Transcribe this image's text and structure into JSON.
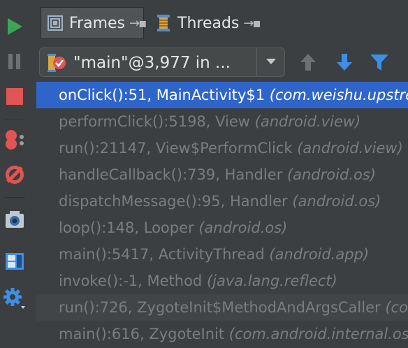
{
  "tabs": [
    {
      "label": "Frames",
      "pin": "→▪"
    },
    {
      "label": "Threads",
      "pin": "→▪"
    }
  ],
  "thread_selector": {
    "value": "\"main\"@3,977 in ..."
  },
  "colors": {
    "run": "#3aa655",
    "stop": "#e05555",
    "selection": "#2f65ca",
    "arrow_blue": "#3d8ee6",
    "filter_blue": "#3d8ee6"
  },
  "toolbar_icons": [
    "resume-icon",
    "pause-icon",
    "stop-icon",
    "view-breakpoints-icon",
    "mute-breakpoints-icon",
    "camera-icon",
    "layout-icon",
    "settings-icon"
  ],
  "frames": [
    {
      "method": "onClick():51, MainActivity$1 ",
      "pkg": "(com.weishu.upstream)",
      "selected": true
    },
    {
      "method": "performClick():5198, View ",
      "pkg": "(android.view)"
    },
    {
      "method": "run():21147, View$PerformClick ",
      "pkg": "(android.view)"
    },
    {
      "method": "handleCallback():739, Handler ",
      "pkg": "(android.os)"
    },
    {
      "method": "dispatchMessage():95, Handler ",
      "pkg": "(android.os)"
    },
    {
      "method": "loop():148, Looper ",
      "pkg": "(android.os)"
    },
    {
      "method": "main():5417, ActivityThread ",
      "pkg": "(android.app)"
    },
    {
      "method": "invoke():-1, Method ",
      "pkg": "(java.lang.reflect)"
    },
    {
      "method": "run():726, ZygoteInit$MethodAndArgsCaller ",
      "pkg": "(com.android.internal.os)"
    },
    {
      "method": "main():616, ZygoteInit ",
      "pkg": "(com.android.internal.os)"
    }
  ]
}
